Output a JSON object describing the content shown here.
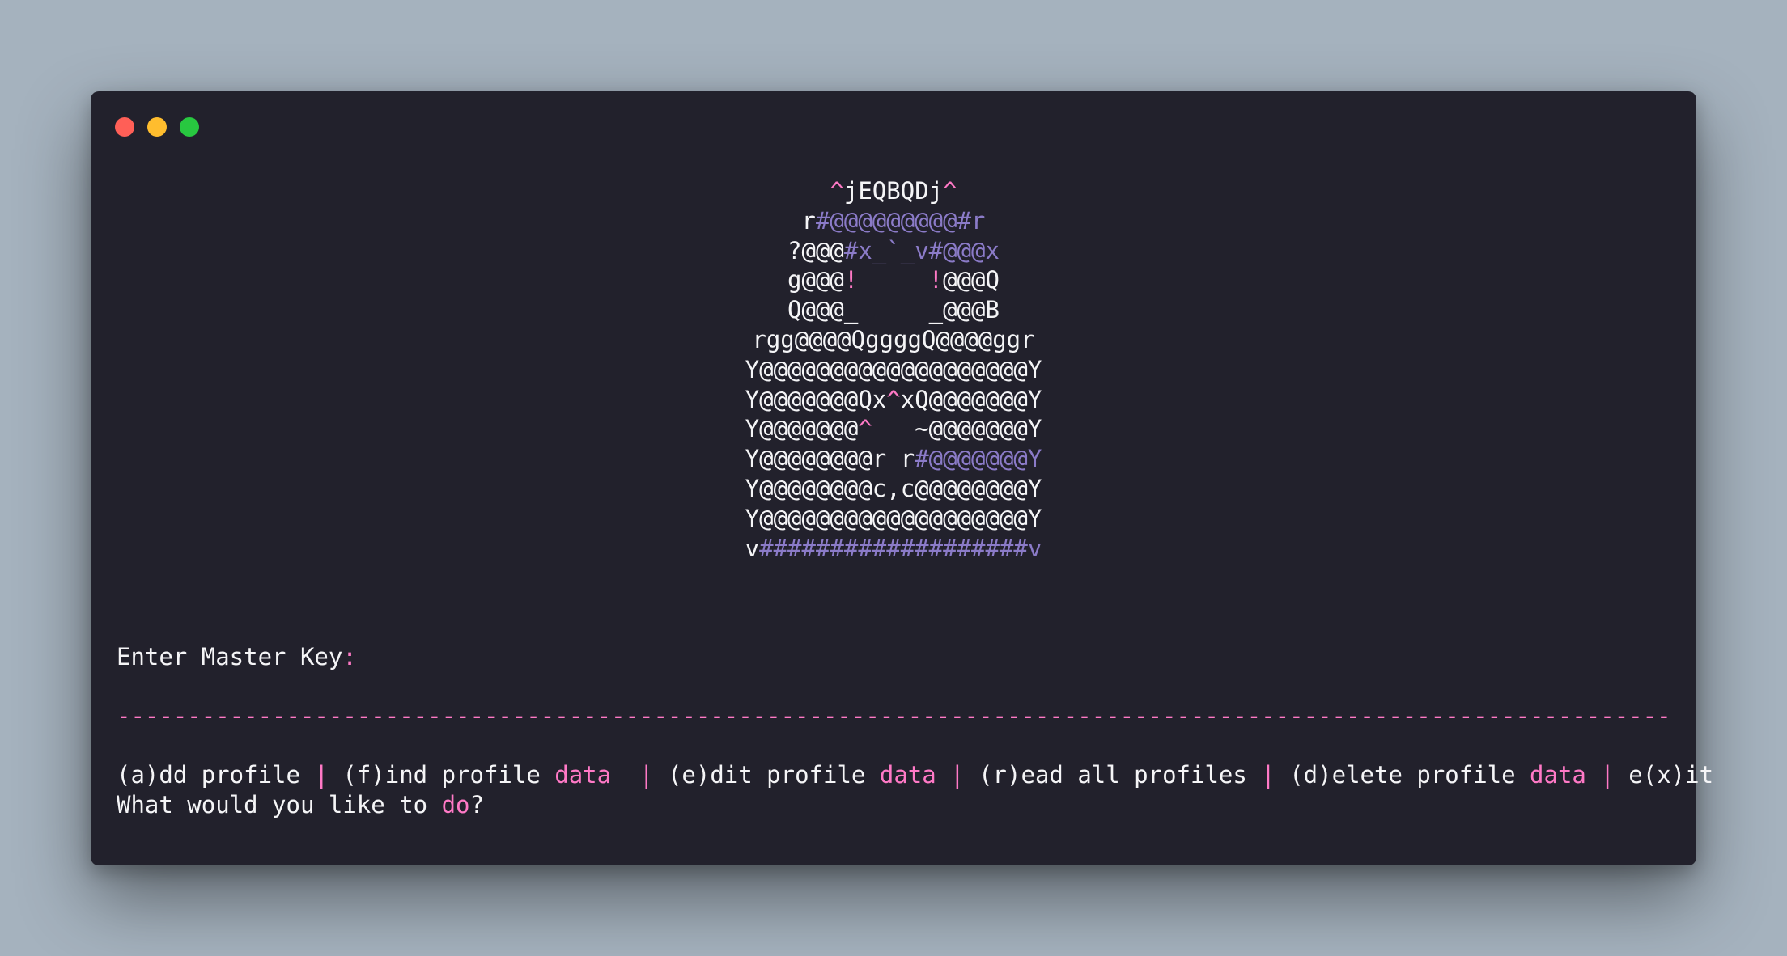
{
  "window": {
    "controls": [
      "close",
      "minimize",
      "zoom"
    ],
    "colors": {
      "close": "#ff5f57",
      "minimize": "#ffbd2e",
      "zoom": "#28c840"
    }
  },
  "theme": {
    "background": "#22212c",
    "text": "#f5f5f7",
    "accent": "#ff79c6",
    "muted": "#8b7bc8"
  },
  "ascii_logo": [
    [
      [
        "p",
        "^"
      ],
      [
        "w",
        "jEQBQDj"
      ],
      [
        "p",
        "^"
      ]
    ],
    [
      [
        "w",
        "r"
      ],
      [
        "v",
        "#@@@@@@@@@#r"
      ]
    ],
    [
      [
        "w",
        "?@@@"
      ],
      [
        "v",
        "#x_`_v#@@@x"
      ]
    ],
    [
      [
        "w",
        "g@@@"
      ],
      [
        "p",
        "!"
      ],
      [
        "w",
        "     "
      ],
      [
        "p",
        "!"
      ],
      [
        "w",
        "@@@Q"
      ]
    ],
    [
      [
        "w",
        "Q@@@_     _@@@B"
      ]
    ],
    [
      [
        "w",
        "rgg@@@@QggggQ@@@@ggr"
      ]
    ],
    [
      [
        "w",
        "Y@@@@@@@@@@@@@@@@@@@Y"
      ]
    ],
    [
      [
        "w",
        "Y@@@@@@@Qx"
      ],
      [
        "p",
        "^"
      ],
      [
        "w",
        "xQ@@@@@@@Y"
      ]
    ],
    [
      [
        "w",
        "Y@@@@@@@"
      ],
      [
        "p",
        "^"
      ],
      [
        "w",
        "   ~@@@@@@@Y"
      ]
    ],
    [
      [
        "w",
        "Y@@@@@@@@r r"
      ],
      [
        "v",
        "#@@@@@@@Y"
      ]
    ],
    [
      [
        "w",
        "Y@@@@@@@@c,c@@@@@@@@Y"
      ]
    ],
    [
      [
        "w",
        "Y@@@@@@@@@@@@@@@@@@@Y"
      ]
    ],
    [
      [
        "w",
        "v"
      ],
      [
        "v",
        "###################v"
      ]
    ]
  ],
  "prompt": {
    "label": "Enter Master Key",
    "separator": ":"
  },
  "divider": "---------------------------------------------------------------------------------------------------------------------------------",
  "menu": {
    "options": [
      {
        "parts": [
          [
            "w",
            "(a)dd profile "
          ]
        ]
      },
      {
        "parts": [
          [
            "w",
            " (f)ind profile "
          ],
          [
            "p",
            "data"
          ],
          [
            "w",
            "  "
          ]
        ]
      },
      {
        "parts": [
          [
            "w",
            " (e)dit profile "
          ],
          [
            "p",
            "data"
          ],
          [
            "w",
            " "
          ]
        ]
      },
      {
        "parts": [
          [
            "w",
            " (r)ead all profiles "
          ]
        ]
      },
      {
        "parts": [
          [
            "w",
            " (d)elete profile "
          ],
          [
            "p",
            "data"
          ],
          [
            "w",
            " "
          ]
        ]
      },
      {
        "parts": [
          [
            "w",
            " e(x)it"
          ]
        ]
      }
    ],
    "separator": "|",
    "question_parts": [
      [
        "w",
        "What would you like to "
      ],
      [
        "p",
        "do"
      ],
      [
        "w",
        "?"
      ]
    ]
  }
}
